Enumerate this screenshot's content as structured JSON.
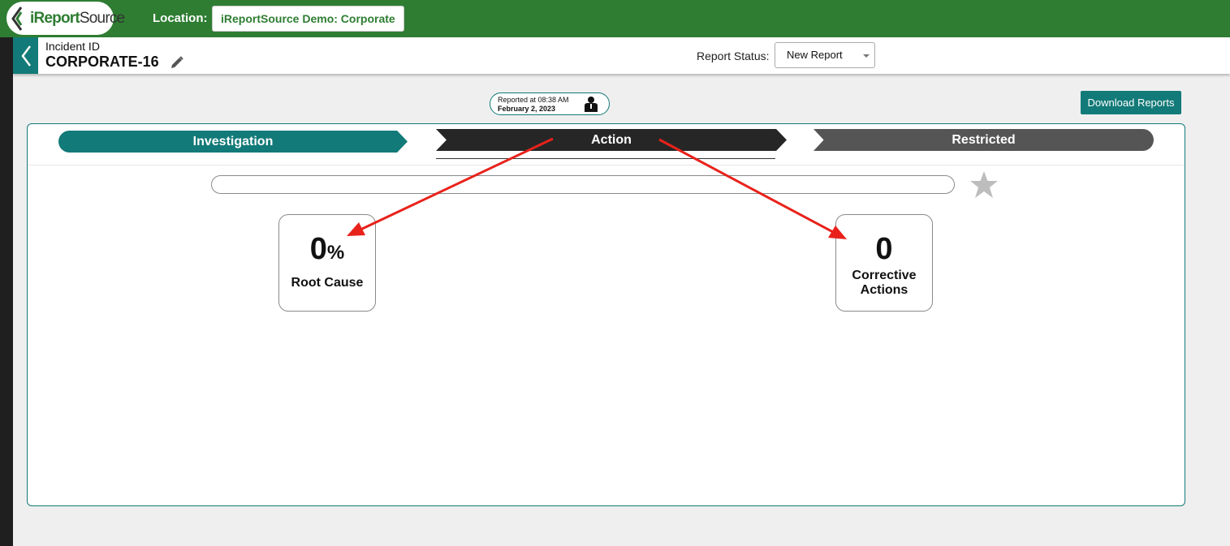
{
  "topbar": {
    "logo_text_a": "iReport",
    "logo_text_b": "Source",
    "location_label": "Location:",
    "location_value": "iReportSource Demo: Corporate"
  },
  "header": {
    "incident_label": "Incident ID",
    "incident_id": "CORPORATE-16",
    "status_label": "Report Status:",
    "status_value": "New Report"
  },
  "reported": {
    "line1": "Reported at 08:38 AM",
    "line2": "February 2, 2023"
  },
  "download_label": "Download Reports",
  "steps": [
    {
      "label": "Investigation"
    },
    {
      "label": "Action"
    },
    {
      "label": "Restricted"
    }
  ],
  "cards": {
    "root_cause": {
      "value": "0",
      "unit": "%",
      "label": "Root Cause"
    },
    "corrective_actions": {
      "value": "0",
      "label": "Corrective Actions"
    }
  },
  "colors": {
    "brand_green": "#2e7d32",
    "teal": "#127a78",
    "annotation_red": "#e8221b"
  }
}
